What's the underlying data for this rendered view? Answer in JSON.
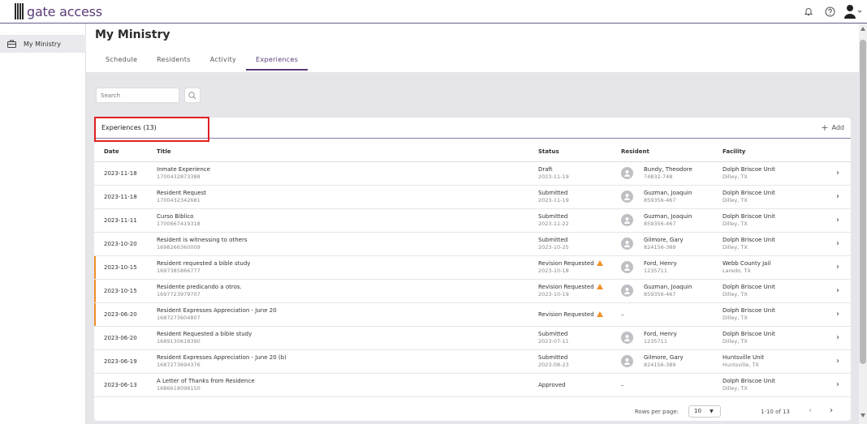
{
  "app": {
    "logo_text": "gate access"
  },
  "header": {
    "icons": [
      "bell-icon",
      "help-icon",
      "user-avatar-icon"
    ]
  },
  "sidebar": {
    "items": [
      {
        "label": "My Ministry",
        "icon": "briefcase-icon"
      }
    ]
  },
  "page": {
    "title": "My Ministry",
    "tabs": [
      {
        "label": "Schedule",
        "active": false
      },
      {
        "label": "Residents",
        "active": false
      },
      {
        "label": "Activity",
        "active": false
      },
      {
        "label": "Experiences",
        "active": true
      }
    ]
  },
  "search": {
    "placeholder": "Search"
  },
  "card": {
    "title": "Experiences (13)",
    "add_label": "Add"
  },
  "table": {
    "columns": [
      "Date",
      "Title",
      "Status",
      "Resident",
      "Facility"
    ],
    "rows": [
      {
        "date": "2023-11-18",
        "title": "Inmate Experience",
        "id": "1700432873388",
        "status": "Draft",
        "status_date": "2023-11-19",
        "warn": false,
        "resident": "Bundy, Theodore",
        "resident_id": "74832-748",
        "facility": "Dolph Briscoe Unit",
        "location": "Dilley, TX"
      },
      {
        "date": "2023-11-18",
        "title": "Resident Request",
        "id": "1700432342681",
        "status": "Submitted",
        "status_date": "2023-11-19",
        "warn": false,
        "resident": "Guzman, Joaquin",
        "resident_id": "859356-467",
        "facility": "Dolph Briscoe Unit",
        "location": "Dilley, TX"
      },
      {
        "date": "2023-11-11",
        "title": "Curso Biblico",
        "id": "1700667419318",
        "status": "Submitted",
        "status_date": "2023-11-22",
        "warn": false,
        "resident": "Guzman, Joaquin",
        "resident_id": "859356-467",
        "facility": "Dolph Briscoe Unit",
        "location": "Dilley, TX"
      },
      {
        "date": "2023-10-20",
        "title": "Resident is witnessing to others",
        "id": "1698266360009",
        "status": "Submitted",
        "status_date": "2023-10-25",
        "warn": false,
        "resident": "Gilmore, Gary",
        "resident_id": "824156-389",
        "facility": "Dolph Briscoe Unit",
        "location": "Dilley, TX"
      },
      {
        "date": "2023-10-15",
        "title": "Resident requested a bible study",
        "id": "1697385866777",
        "status": "Revision Requested",
        "status_date": "2023-10-18",
        "warn": true,
        "resident": "Ford, Henry",
        "resident_id": "1235711",
        "facility": "Webb County Jail",
        "location": "Laredo, TX"
      },
      {
        "date": "2023-10-15",
        "title": "Residente predicando a otros.",
        "id": "1697723979707",
        "status": "Revision Requested",
        "status_date": "2023-10-19",
        "warn": true,
        "resident": "Guzman, Joaquin",
        "resident_id": "859356-467",
        "facility": "Dolph Briscoe Unit",
        "location": "Dilley, TX"
      },
      {
        "date": "2023-06-20",
        "title": "Resident Expresses Appreciation - June 20",
        "id": "1687273604807",
        "status": "Revision Requested",
        "status_date": "",
        "warn": true,
        "resident": "–",
        "resident_id": "",
        "facility": "Dolph Briscoe Unit",
        "location": "Dilley, TX"
      },
      {
        "date": "2023-06-20",
        "title": "Resident Requested a bible study",
        "id": "1689130618390",
        "status": "Submitted",
        "status_date": "2023-07-11",
        "warn": false,
        "resident": "Ford, Henry",
        "resident_id": "1235711",
        "facility": "Dolph Briscoe Unit",
        "location": "Dilley, TX"
      },
      {
        "date": "2023-06-19",
        "title": "Resident Expresses Appreciation - June 20 (b)",
        "id": "1687273694376",
        "status": "Submitted",
        "status_date": "2023-08-23",
        "warn": false,
        "resident": "Gilmore, Gary",
        "resident_id": "824156-389",
        "facility": "Huntsville Unit",
        "location": "Huntsville, TX"
      },
      {
        "date": "2023-06-13",
        "title": "A Letter of Thanks from Residence",
        "id": "1686618098150",
        "status": "Approved",
        "status_date": "",
        "warn": false,
        "resident": "–",
        "resident_id": "",
        "facility": "Dolph Briscoe Unit",
        "location": "Dilley, TX"
      }
    ]
  },
  "pagination": {
    "rows_per_page_label": "Rows per page:",
    "rows_per_page": "10",
    "range": "1-10 of 13"
  },
  "colors": {
    "accent": "#5a3b78",
    "warning": "#f0902a",
    "highlight": "#e02020"
  }
}
